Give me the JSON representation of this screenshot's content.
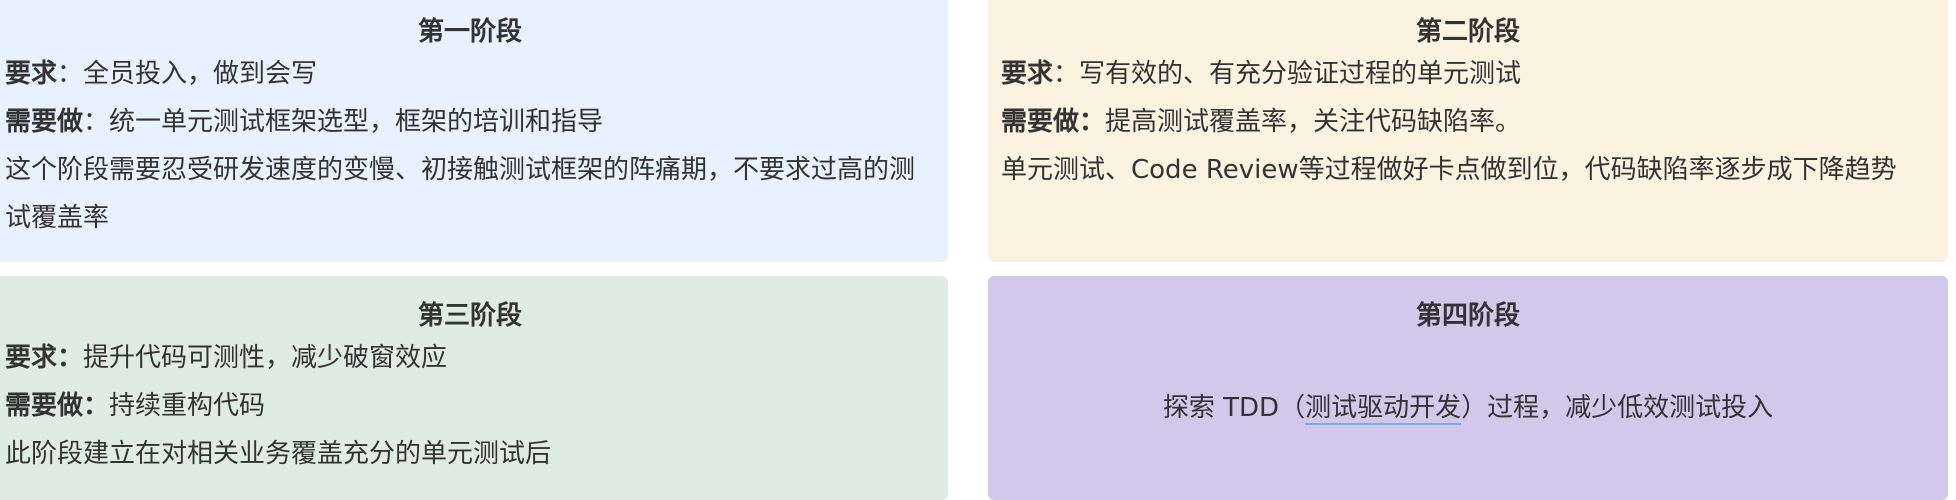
{
  "cards": [
    {
      "title": "第一阶段",
      "req_label": "要求",
      "req_text": "：全员投入，做到会写",
      "todo_label": "需要做",
      "todo_text": "：统一单元测试框架选型，框架的培训和指导",
      "note": "这个阶段需要忍受研发速度的变慢、初接触测试框架的阵痛期，不要求过高的测试覆盖率",
      "color": "#e8f2fe"
    },
    {
      "title": "第二阶段",
      "req_label": "要求",
      "req_text": "：写有效的、有充分验证过程的单元测试",
      "todo_label": "需要做：",
      "todo_text": "提高测试覆盖率，关注代码缺陷率。",
      "note": "单元测试、Code Review等过程做好卡点做到位，代码缺陷率逐步成下降趋势",
      "color": "#fbf3df"
    },
    {
      "title": "第三阶段",
      "req_label": "要求：",
      "req_text": "提升代码可测性，减少破窗效应",
      "todo_label": "需要做：",
      "todo_text": "持续重构代码",
      "note": "此阶段建立在对相关业务覆盖充分的单元测试后",
      "color": "#dfece6"
    },
    {
      "title": "第四阶段",
      "text_before": "探索 TDD（",
      "text_link": "测试驱动开发",
      "text_after": "）过程，减少低效测试投入",
      "color": "#d2c8ea"
    }
  ]
}
